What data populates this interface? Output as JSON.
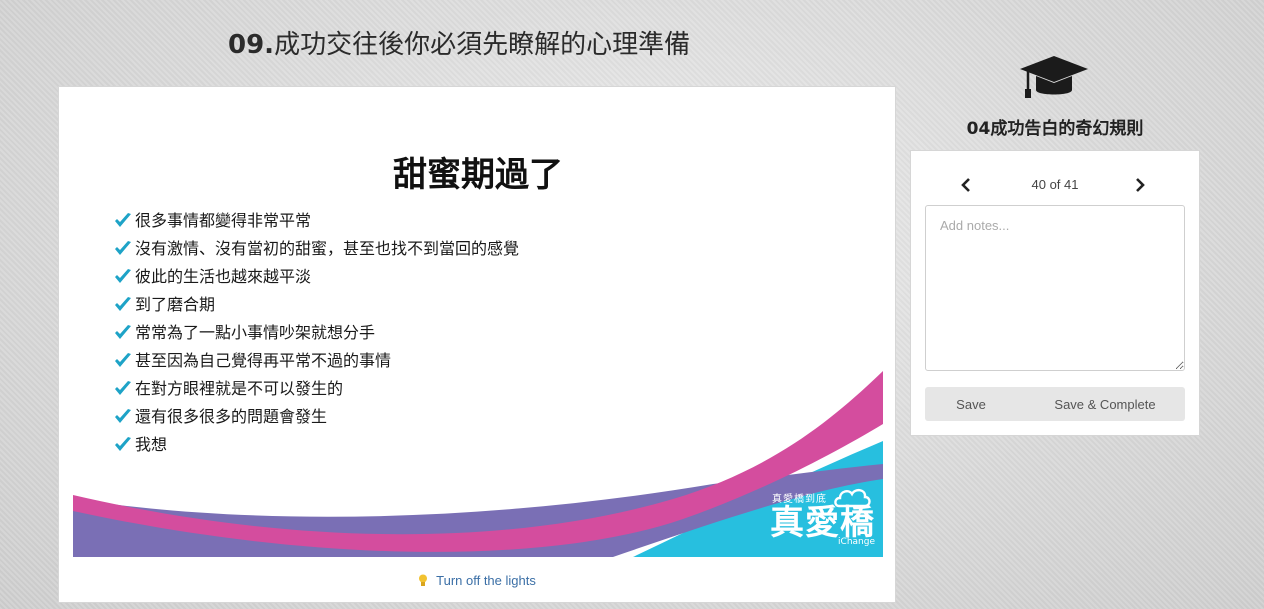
{
  "lesson": {
    "number": "09.",
    "title": "成功交往後你必須先瞭解的心理準備"
  },
  "slide": {
    "heading": "甜蜜期過了",
    "bullets": [
      "很多事情都變得非常平常",
      "沒有激情、沒有當初的甜蜜，甚至也找不到當回的感覺",
      "彼此的生活也越來越平淡",
      "到了磨合期",
      "常常為了一點小事情吵架就想分手",
      "甚至因為自己覺得再平常不過的事情",
      "在對方眼裡就是不可以發生的",
      "還有很多很多的問題會發生",
      "我想"
    ],
    "brand": {
      "tagline": "真愛橋到底",
      "name": "真愛橋",
      "english": "iChange"
    },
    "colors": {
      "check": "#1ea3c7",
      "magenta": "#d44d9e",
      "purple": "#7a6fb5",
      "cyan": "#27bfdf"
    }
  },
  "player": {
    "lights_label": "Turn off the lights",
    "lights_icon": "lightbulb-icon"
  },
  "sidebar": {
    "course_icon": "graduation-cap-icon",
    "course_name": "04成功告白的奇幻規則",
    "pager": {
      "current": 40,
      "total": 41,
      "label": "40 of 41"
    },
    "notes_placeholder": "Add notes...",
    "save_label": "Save",
    "complete_label": "Save & Complete"
  }
}
